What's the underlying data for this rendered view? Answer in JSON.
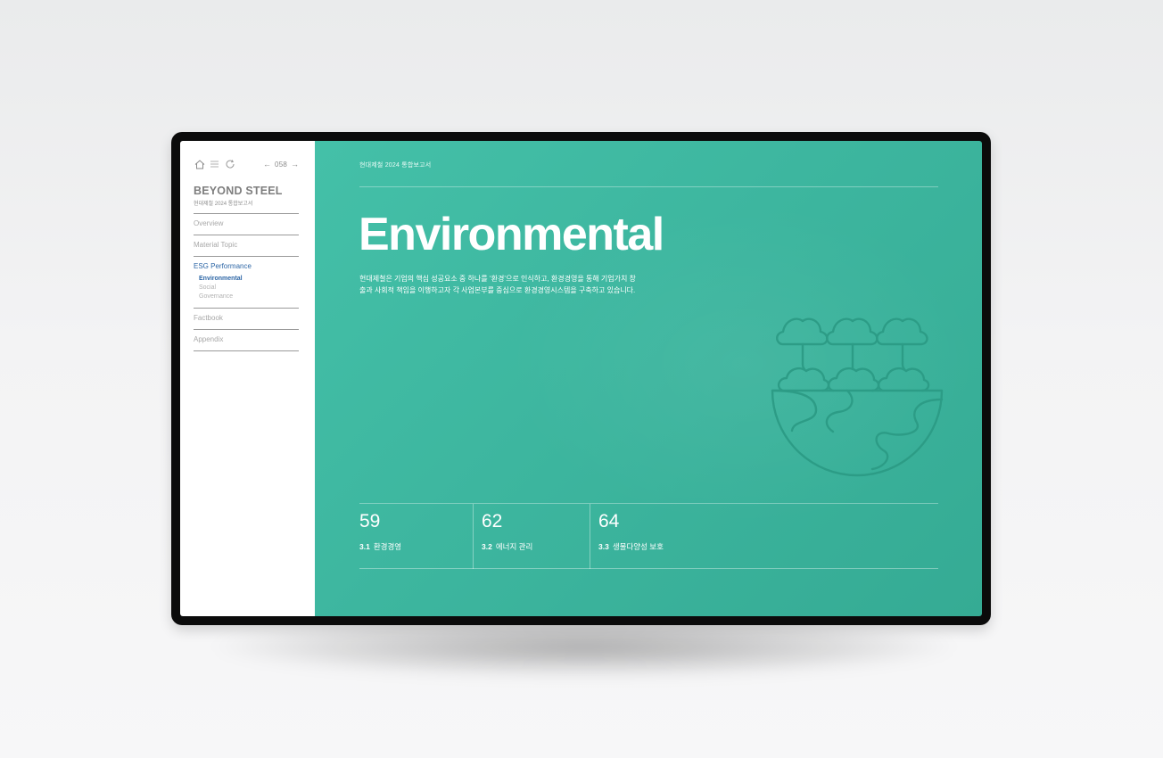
{
  "sidebar": {
    "page_number": "058",
    "prev_arrow": "←",
    "next_arrow": "→",
    "brand": "BEYOND STEEL",
    "brand_sub": "현대제철 2024 통합보고서",
    "nav": [
      {
        "label": "Overview"
      },
      {
        "label": "Material Topic"
      },
      {
        "label": "ESG Performance",
        "active": true,
        "children": [
          "Environmental",
          "Social",
          "Governance"
        ]
      },
      {
        "label": "Factbook"
      },
      {
        "label": "Appendix"
      }
    ]
  },
  "main": {
    "report_title": "현대제철 2024 통합보고서",
    "heading": "Environmental",
    "description": "현대제철은 기업의 핵심 성공요소 중 하나를 ‘환경’으로 인식하고, 환경경영을 통해 기업가치 창출과 사회적 책임을 이행하고자 각 사업본부를 중심으로 환경경영시스템을 구축하고 있습니다.",
    "illustration_icon": "tree-globe-icon",
    "stats": [
      {
        "page": "59",
        "number": "3.1",
        "label": "환경경영"
      },
      {
        "page": "62",
        "number": "3.2",
        "label": "에너지 관리"
      },
      {
        "page": "64",
        "number": "3.3",
        "label": "생물다양성 보호"
      }
    ]
  },
  "colors": {
    "accent_green": "#3db69f",
    "active_nav_blue": "#2d66a6",
    "device_frame": "#0b0b0b"
  }
}
